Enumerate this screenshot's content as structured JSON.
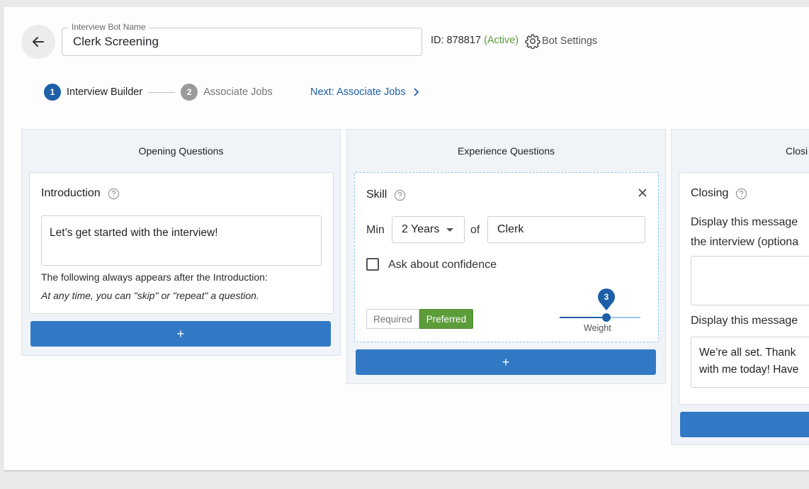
{
  "header": {
    "name_legend": "Interview Bot Name",
    "name_value": "Clerk Screening",
    "id_text": "ID: 878817",
    "status_text": "(Active)",
    "settings_label": "Bot Settings",
    "colors": {
      "active": "#5c9c3b",
      "primary": "#1d5fa8"
    }
  },
  "stepper": {
    "steps": [
      {
        "num": "1",
        "label": "Interview Builder"
      },
      {
        "num": "2",
        "label": "Associate Jobs"
      }
    ],
    "next_label": "Next: Associate Jobs"
  },
  "columns": {
    "opening": {
      "title": "Opening Questions",
      "card_title": "Introduction",
      "message": "Let’s get started with the interview!",
      "note": "The following always appears after the Introduction:",
      "note_italic": "At any time, you can \"skip\" or \"repeat\" a question.",
      "add_label": "+"
    },
    "experience": {
      "title": "Experience Questions",
      "card_title": "Skill",
      "min_label": "Min",
      "years_value": "2 Years",
      "of_label": "of",
      "skill_value": "Clerk",
      "confidence_label": "Ask about confidence",
      "required_label": "Required",
      "preferred_label": "Preferred",
      "weight_value": "3",
      "weight_label": "Weight",
      "add_label": "+"
    },
    "closing": {
      "title": "Closi",
      "card_title": "Closing",
      "display_msg_1a": "Display this message",
      "display_msg_1b": "the interview (optiona",
      "display_msg_2": "Display this message",
      "closing_text_1": "We’re all set. Thank",
      "closing_text_2": "with me today! Have"
    }
  }
}
